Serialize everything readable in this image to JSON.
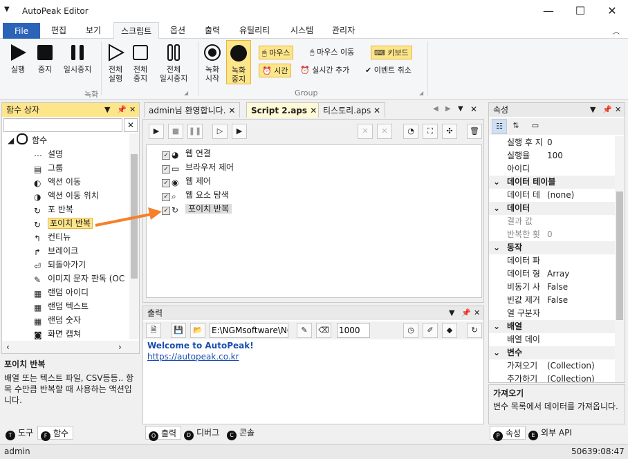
{
  "window": {
    "title": "AutoPeak Editor"
  },
  "ribbon_tabs": [
    "File",
    "편집",
    "보기",
    "스크립트",
    "옵션",
    "출력",
    "유틸리티",
    "시스템",
    "관리자"
  ],
  "ribbon": {
    "run": "실행",
    "stop": "중지",
    "pause": "일시중지",
    "all_run": [
      "전체",
      "실행"
    ],
    "all_stop": [
      "전체",
      "중지"
    ],
    "all_pause": [
      "전체",
      "일시중지"
    ],
    "rec_start": [
      "녹화",
      "시작"
    ],
    "rec_stop": [
      "녹화",
      "중지"
    ],
    "mouse": "마우스",
    "mouse_move": "마우스 이동",
    "keyboard": "키보드",
    "time": "시간",
    "realtime_add": "실시간 추가",
    "event_cancel": "이벤트 취소",
    "group1_label": "녹화",
    "group2_label": "Group"
  },
  "func_box": {
    "title": "함수 상자",
    "root": "함수",
    "items": [
      "설명",
      "그룹",
      "액션 이동",
      "액션 이동 위치",
      "포 반복",
      "포이치 반복",
      "컨티뉴",
      "브레이크",
      "되돌아가기",
      "이미지 문자 판독 (OC",
      "랜덤 아이디",
      "랜덤 텍스트",
      "랜덤 숫자",
      "화면 캡쳐"
    ],
    "desc_title": "포이치 반복",
    "desc_text": "배열 또는 텍스트 파일, CSV등등.. 항목 수만큼 반복할 때 사용하는 액션입니다.",
    "tab_tool": "도구",
    "tab_func": "함수"
  },
  "doc_tabs": [
    "admin님 환영합니다.",
    "Script 2.aps",
    "티스토리.aps"
  ],
  "script_items": [
    "웹 연결",
    "브라우저 제어",
    "웹 제어",
    "웹 요소 탐색",
    "포이치 반복"
  ],
  "output": {
    "title": "출력",
    "path": "E:\\NGMsoftware\\NG",
    "count": "1000",
    "welcome": "Welcome to AutoPeak!",
    "link": "https://autopeak.co.kr",
    "tab_output": "출력",
    "tab_debug": "디버그",
    "tab_console": "콘솔"
  },
  "props": {
    "title": "속성",
    "rows": [
      {
        "k": "실행 후 지",
        "v": "0",
        "cat": false
      },
      {
        "k": "실행율",
        "v": "100",
        "cat": false
      },
      {
        "k": "아이디",
        "v": "",
        "cat": false
      },
      {
        "k": "데이터 테이블",
        "v": "",
        "cat": true
      },
      {
        "k": "데이터 테",
        "v": "(none)",
        "cat": false
      },
      {
        "k": "데이터",
        "v": "",
        "cat": true
      },
      {
        "k": "결과 값",
        "v": "",
        "cat": false,
        "muted": true
      },
      {
        "k": "반복한 횟",
        "v": "0",
        "cat": false,
        "muted": true
      },
      {
        "k": "동작",
        "v": "",
        "cat": true
      },
      {
        "k": "데이터 파",
        "v": "",
        "cat": false
      },
      {
        "k": "데이터 형",
        "v": "Array",
        "cat": false
      },
      {
        "k": "비동기 사",
        "v": "False",
        "cat": false
      },
      {
        "k": "빈값 제거",
        "v": "False",
        "cat": false
      },
      {
        "k": "열 구분자",
        "v": "",
        "cat": false
      },
      {
        "k": "배열",
        "v": "",
        "cat": true
      },
      {
        "k": "배열 데이",
        "v": "",
        "cat": false
      },
      {
        "k": "변수",
        "v": "",
        "cat": true
      },
      {
        "k": "가져오기",
        "v": "(Collection)",
        "cat": false
      },
      {
        "k": "추가하기",
        "v": "(Collection)",
        "cat": false
      }
    ],
    "desc_title": "가져오기",
    "desc_text": "변수 목록에서 데이터를 가져옵니다.",
    "tab_props": "속성",
    "tab_api": "외부 API"
  },
  "status": {
    "user": "admin",
    "time": "50639:08:47"
  },
  "colors": {
    "accent": "#2b63b8",
    "highlight": "#fde58a",
    "arrow": "#f4812a",
    "link": "#1a4db0"
  }
}
